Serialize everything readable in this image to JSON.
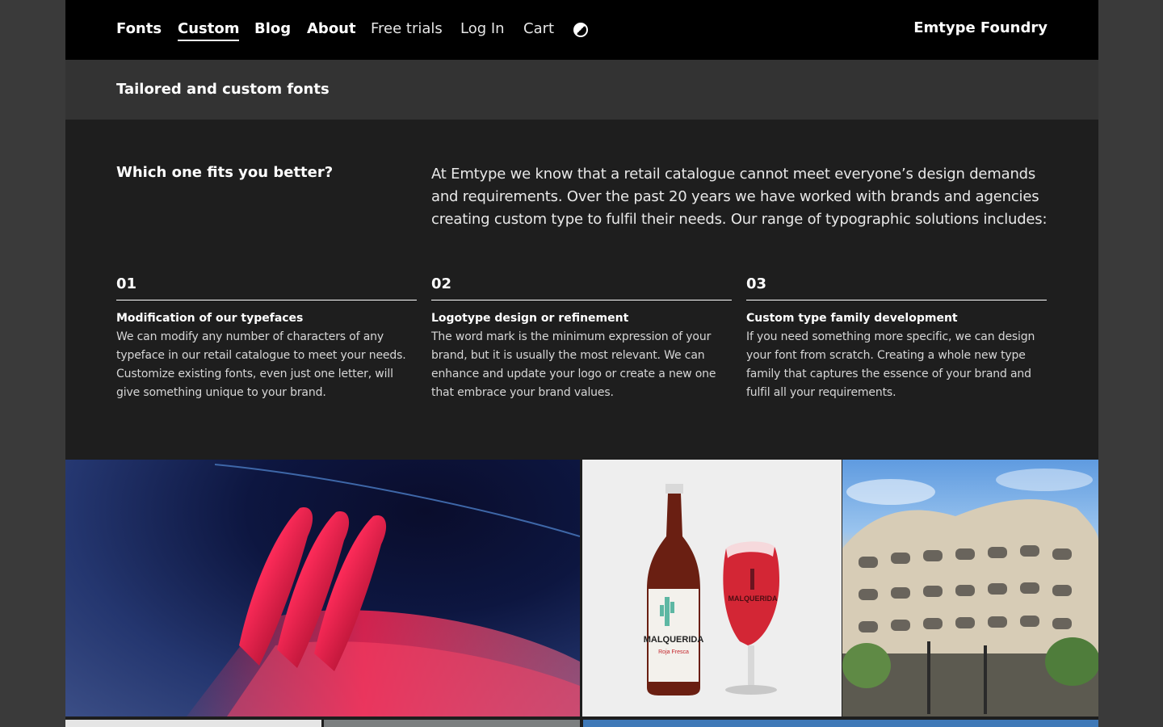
{
  "nav": {
    "items": [
      {
        "label": "Fonts"
      },
      {
        "label": "Custom"
      },
      {
        "label": "Blog"
      },
      {
        "label": "About"
      },
      {
        "label": "Free trials"
      },
      {
        "label": "Log In"
      },
      {
        "label": "Cart"
      }
    ],
    "active": "Custom",
    "theme_toggle_icon": "contrast-icon",
    "brand": "Emtype Foundry"
  },
  "subheader": {
    "title": "Tailored and custom fonts"
  },
  "intro": {
    "heading": "Which one fits you better?",
    "text": "At Emtype we know that a retail catalogue cannot meet everyone’s design demands and requirements. Over the past 20 years we have worked with brands and agencies creating custom type to fulfil their needs. Our range of typographic solutions includes:"
  },
  "services": [
    {
      "number": "01",
      "title": "Modification of our typefaces",
      "text": "We can modify any number of characters of any typeface in our retail catalogue to meet your needs. Customize existing fonts, even just one letter, will give something unique to your brand."
    },
    {
      "number": "02",
      "title": "Logotype design or refinement",
      "text": "The word mark is the minimum expression of your brand, but it is usually the most relevant. We can enhance and update your logo or create a new one that embrace your brand values."
    },
    {
      "number": "03",
      "title": "Custom type family development",
      "text": "If you need something more specific, we can design your font from scratch. Creating a whole new type family that captures the essence of your brand and fulfil all your requirements."
    }
  ],
  "gallery": {
    "beer_label_text": "MALQUERIDA",
    "beer_sublabel_text": "Roja Fresca",
    "glass_label_text": "MALQUERIDA"
  },
  "colors": {
    "page_bg": "#3a3a3a",
    "content_bg": "#1e1e1e",
    "nav_bg": "#000000",
    "subheader_bg": "#333333",
    "text": "#ffffff"
  }
}
